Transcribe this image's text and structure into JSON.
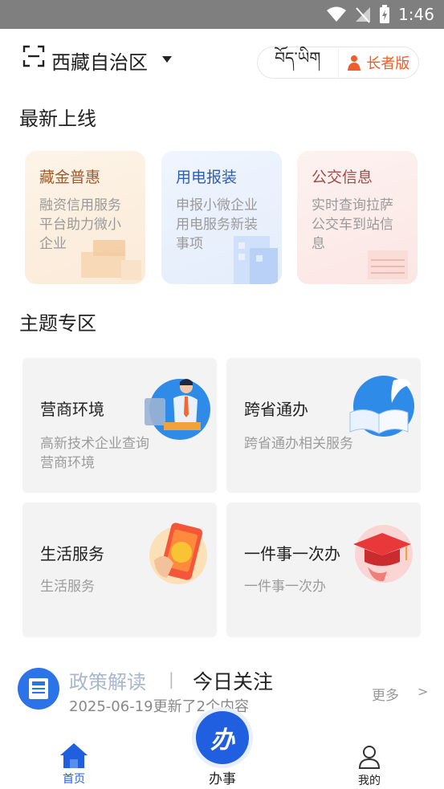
{
  "status_bar": {
    "time": "1:46"
  },
  "header": {
    "region": "西藏自治区",
    "lang_label": "བོད་ཡིག",
    "elder_label": "长者版"
  },
  "latest": {
    "title": "最新上线",
    "cards": [
      {
        "title": "藏金普惠",
        "desc": "融资信用服务平台助力微小企业",
        "title_color": "#a25a2a",
        "bg": "#fdf3e6"
      },
      {
        "title": "用电报装",
        "desc": "申报小微企业用电服务新装事项",
        "title_color": "#2d5fb0",
        "bg": "#eef3fd"
      },
      {
        "title": "公交信息",
        "desc": "实时查询拉萨公交车到站信息",
        "title_color": "#a24a48",
        "bg": "#fdf0ef"
      }
    ]
  },
  "themes": {
    "title": "主题专区",
    "cards": [
      {
        "title": "营商环境",
        "desc": "高新技术企业查询营商环境",
        "icon": "businessman-icon"
      },
      {
        "title": "跨省通办",
        "desc": "跨省通办相关服务",
        "icon": "book-quill-icon"
      },
      {
        "title": "生活服务",
        "desc": "生活服务",
        "icon": "phone-life-icon"
      },
      {
        "title": "一件事一次办",
        "desc": "一件事一次办",
        "icon": "graduation-cap-icon"
      }
    ]
  },
  "news": {
    "policy_label": "政策解读",
    "separator": "|",
    "today_label": "今日关注",
    "subtitle": "2025-06-19更新了2个内容",
    "more_label": "更多",
    "more_arrow": ">"
  },
  "tabbar": {
    "home_label": "首页",
    "center_label": "办事",
    "center_icon_text": "办",
    "mine_label": "我的",
    "active_color": "#1f5fe0"
  }
}
